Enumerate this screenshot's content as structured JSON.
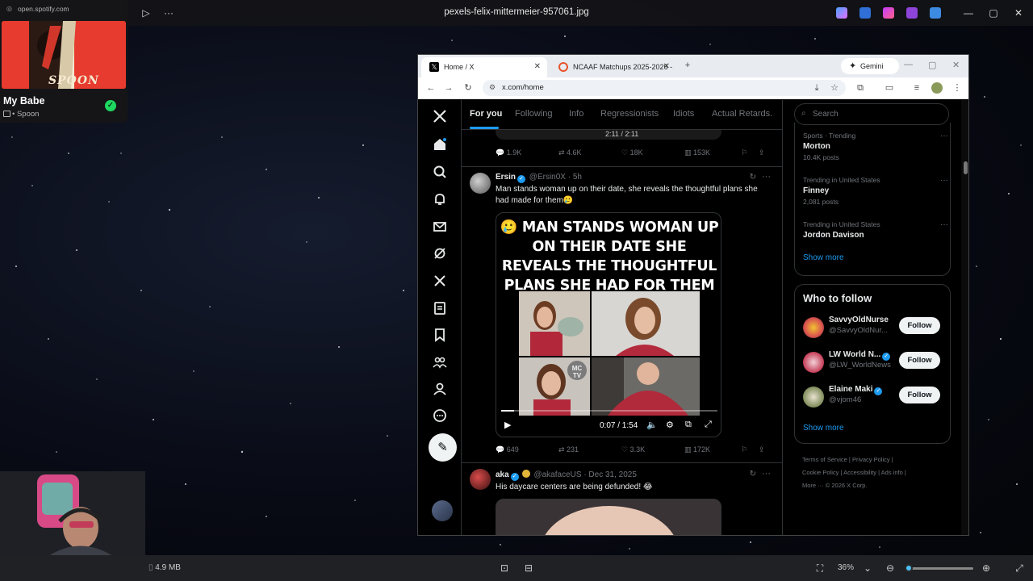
{
  "viewer": {
    "filename": "pexels-felix-mittermeier-957061.jpg",
    "file_size": "4.9 MB",
    "zoom": "36%",
    "zoom_level": 0.36
  },
  "spotify": {
    "url": "open.spotify.com",
    "title": "My Babe",
    "artist": "• Spoon",
    "album_art_text": "SPOON"
  },
  "browser": {
    "tabs": [
      {
        "label": "Home / X",
        "active": true
      },
      {
        "label": "NCAAF Matchups 2025-2026 -",
        "active": false
      }
    ],
    "gemini_label": "Gemini",
    "url": "x.com/home"
  },
  "x": {
    "timeline_tabs": [
      "For you",
      "Following",
      "Info",
      "Regressionists",
      "Idiots",
      "Actual Retards."
    ],
    "prev_tweet_stats": {
      "replies": "1.9K",
      "reposts": "4.6K",
      "likes": "18K",
      "views": "153K"
    },
    "prev_video_time": "2:11 / 2:11",
    "tweets": [
      {
        "name": "Ersin",
        "handle": "@Ersin0X",
        "time": "· 5h",
        "text": "Man stands woman up on their date, she reveals the thoughtful plans she had made for them🥲",
        "video_headline_emoji": "🥲",
        "video_headline": "MAN STANDS WOMAN UP ON THEIR DATE SHE REVEALS THE THOUGHTFUL PLANS SHE HAD FOR THEM",
        "video_watermark": "MC TV",
        "video_time": "0:07 / 1:54",
        "video_progress": 0.061,
        "stats": {
          "replies": "649",
          "reposts": "231",
          "likes": "3.3K",
          "views": "172K"
        }
      },
      {
        "name": "aka",
        "handle": "@akafaceUS",
        "time": "· Dec 31, 2025",
        "text": "His daycare centers are being defunded! 😂"
      }
    ],
    "search_placeholder": "Search",
    "trends": [
      {
        "meta": "Sports · Trending",
        "name": "Morton",
        "count": "10.4K posts"
      },
      {
        "meta": "Trending in United States",
        "name": "Finney",
        "count": "2,081 posts"
      },
      {
        "meta": "Trending in United States",
        "name": "Jordon Davison",
        "count": ""
      }
    ],
    "show_more": "Show more",
    "who_to_follow": {
      "title": "Who to follow",
      "accounts": [
        {
          "name": "SavvyOldNurse",
          "handle": "@SavvyOldNur...",
          "verified": false
        },
        {
          "name": "LW World N...",
          "handle": "@LW_WorldNews",
          "verified": true
        },
        {
          "name": "Elaine Maki",
          "handle": "@vjom46",
          "verified": true
        }
      ],
      "follow_label": "Follow",
      "show_more": "Show more"
    },
    "footer": {
      "line1": "Terms of Service  |  Privacy Policy  |",
      "line2": "Cookie Policy  |  Accessibility  |  Ads info  |",
      "line3": "More ···  © 2026 X Corp."
    }
  },
  "colors": {
    "x_blue": "#1d9bf0",
    "spotify_green": "#1ed760",
    "art_red": "#e63b2e"
  }
}
